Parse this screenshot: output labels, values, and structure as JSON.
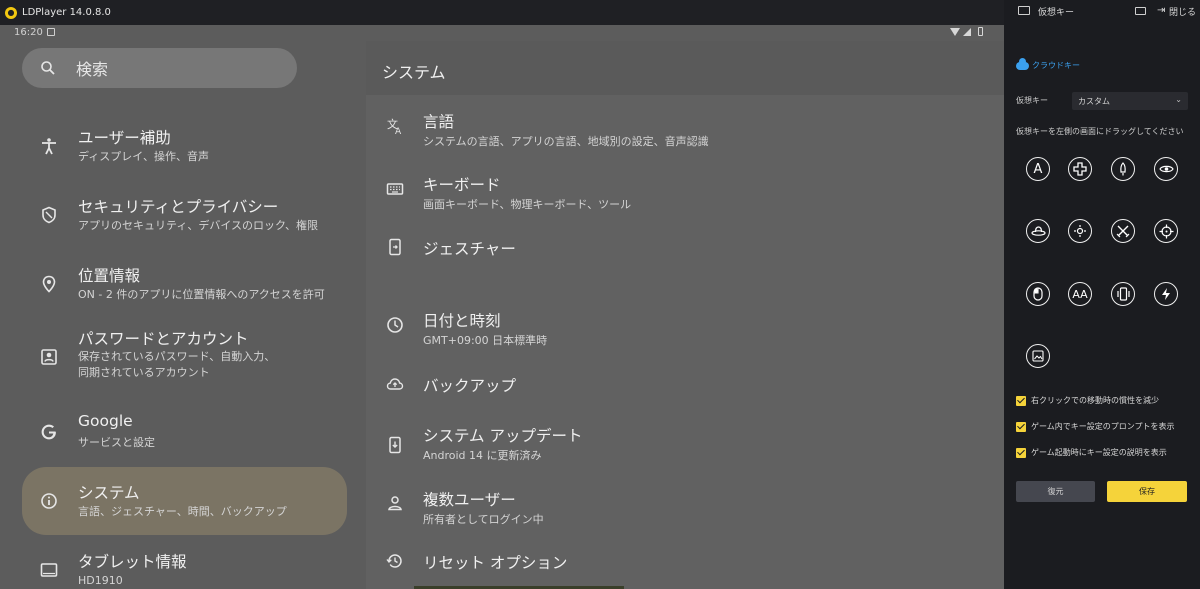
{
  "window": {
    "title": "LDPlayer 14.0.8.0"
  },
  "status_bar": {
    "time": "16:20"
  },
  "left": {
    "search_label": "検索",
    "items": [
      {
        "title": "ユーザー補助",
        "subtitle": "ディスプレイ、操作、音声",
        "icon": "accessibility-icon"
      },
      {
        "title": "セキュリティとプライバシー",
        "subtitle": "アプリのセキュリティ、デバイスのロック、権限",
        "icon": "shield-icon"
      },
      {
        "title": "位置情報",
        "subtitle": "ON - 2 件のアプリに位置情報へのアクセスを許可",
        "icon": "location-pin-icon"
      },
      {
        "title": "パスワードとアカウント",
        "subtitle": "保存されているパスワード、自動入力、",
        "subtitle2": "同期されているアカウント",
        "icon": "account-box-icon"
      },
      {
        "title": "Google",
        "subtitle": "サービスと設定",
        "icon": "google-g-icon"
      },
      {
        "title": "システム",
        "subtitle": "言語、ジェスチャー、時間、バックアップ",
        "icon": "info-icon",
        "selected": true
      },
      {
        "title": "タブレット情報",
        "subtitle": "HD1910",
        "icon": "tablet-icon"
      }
    ]
  },
  "right": {
    "header": "システム",
    "items": [
      {
        "title": "言語",
        "subtitle": "システムの言語、アプリの言語、地域別の設定、音声認識",
        "icon": "translate-icon"
      },
      {
        "title": "キーボード",
        "subtitle": "画面キーボード、物理キーボード、ツール",
        "icon": "keyboard-icon"
      },
      {
        "title": "ジェスチャー",
        "subtitle": "",
        "icon": "gesture-phone-icon"
      },
      {
        "title": "日付と時刻",
        "subtitle": "GMT+09:00 日本標準時",
        "icon": "clock-icon"
      },
      {
        "title": "バックアップ",
        "subtitle": "",
        "icon": "cloud-upload-icon"
      },
      {
        "title": "システム アップデート",
        "subtitle": "Android 14 に更新済み",
        "icon": "system-update-icon"
      },
      {
        "title": "複数ユーザー",
        "subtitle": "所有者としてログイン中",
        "icon": "person-icon"
      },
      {
        "title": "リセット オプション",
        "subtitle": "",
        "icon": "history-icon"
      }
    ]
  },
  "panel": {
    "title": "仮想キー",
    "close_label": "閉じる",
    "cloud_label": "クラウドキー",
    "vk_label": "仮想キー",
    "vk_value": "カスタム",
    "hint": "仮想キーを左側の画面にドラッグしてください",
    "key_icons": [
      [
        "letter-a-key-icon",
        "dpad-key-icon",
        "rocket-key-icon",
        "eye-key-icon"
      ],
      [
        "cowboy-hat-key-icon",
        "joystick-key-icon",
        "crossed-swords-key-icon",
        "crosshair-key-icon"
      ],
      [
        "mouse-key-icon",
        "letters-aa-key-icon",
        "shake-phone-key-icon",
        "lightning-key-icon"
      ],
      [
        "image-key-icon"
      ]
    ],
    "key_a_text": "A",
    "key_aa_text": "AA",
    "checkboxes": [
      "右クリックでの移動時の慣性を減少",
      "ゲーム内でキー設定のプロンプトを表示",
      "ゲーム起動時にキー設定の説明を表示"
    ],
    "restore_label": "復元",
    "save_label": "保存",
    "accent_color": "#f5d33a",
    "cloud_color": "#3ba0ee"
  }
}
